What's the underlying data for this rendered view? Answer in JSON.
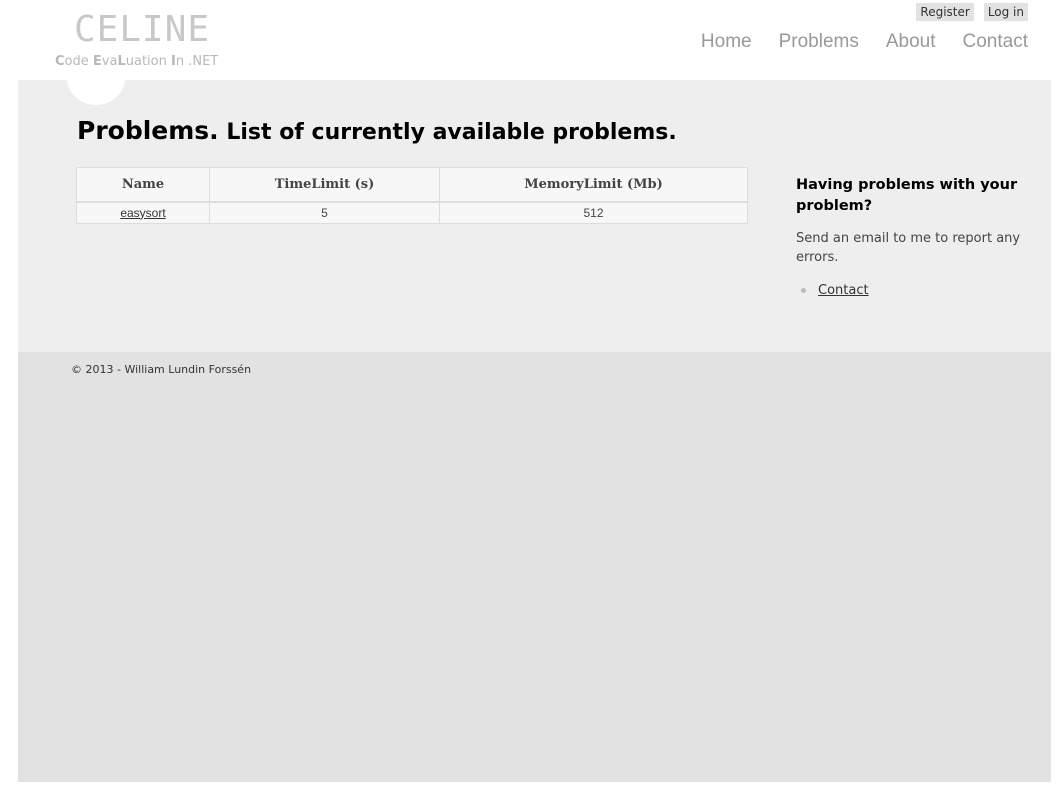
{
  "logo": {
    "title": "CELINE",
    "subtitle_parts": [
      {
        "text": "C",
        "bold": true
      },
      {
        "text": "ode ",
        "bold": false
      },
      {
        "text": "E",
        "bold": true
      },
      {
        "text": "va",
        "bold": false
      },
      {
        "text": "L",
        "bold": true
      },
      {
        "text": "uation ",
        "bold": false
      },
      {
        "text": "I",
        "bold": true
      },
      {
        "text": "n ",
        "bold": false
      },
      {
        "text": ".NET",
        "bold": false
      }
    ]
  },
  "login": {
    "register": "Register",
    "log_in": "Log in"
  },
  "nav": {
    "items": [
      "Home",
      "Problems",
      "About",
      "Contact"
    ]
  },
  "page": {
    "title_strong": "Problems.",
    "title_rest": "List of currently available problems."
  },
  "table": {
    "headers": [
      "Name",
      "TimeLimit (s)",
      "MemoryLimit (Mb)"
    ],
    "rows": [
      {
        "name": "easysort",
        "time_limit": "5",
        "memory_limit": "512"
      }
    ]
  },
  "aside": {
    "heading": "Having problems with your problem?",
    "text": "Send an email to me to report any errors.",
    "links": [
      "Contact"
    ]
  },
  "footer": {
    "copyright": "© 2013 - William Lundin Forssén"
  },
  "colors": {
    "main_bg": "#efeeef",
    "footer_bg": "#e2e2e2",
    "nav_text": "#999999",
    "logo_text": "#c8c8c8"
  }
}
